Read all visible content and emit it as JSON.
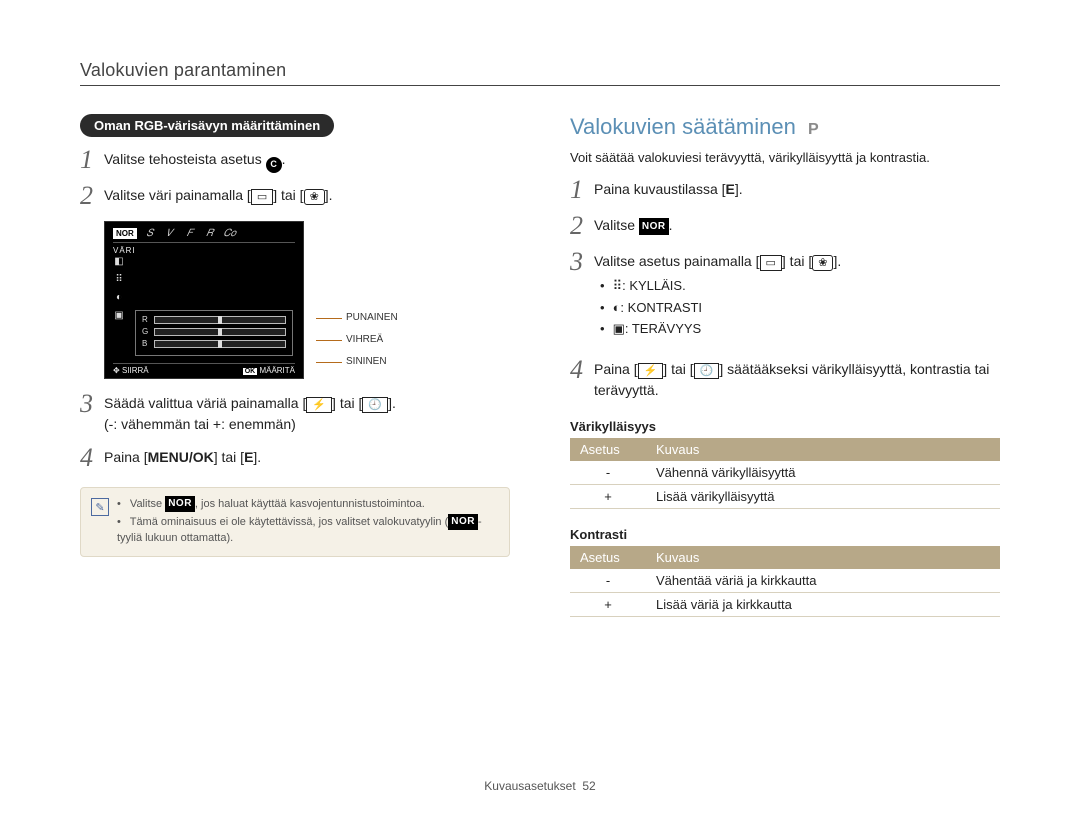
{
  "breadcrumb": "Valokuvien parantaminen",
  "left": {
    "pill": "Oman RGB-värisävyn määrittäminen",
    "step1": "Valitse tehosteista asetus ",
    "step1_icon_name": "C",
    "step2_a": "Valitse väri painamalla [",
    "step2_b": "] tai [",
    "step2_c": "].",
    "lcd": {
      "nor": "NOR",
      "vari": "VÄRI",
      "r": "R",
      "g": "G",
      "b": "B",
      "siirra": "SIIRRÄ",
      "ok": "OK",
      "maarita": "MÄÄRITÄ"
    },
    "callouts": {
      "red": "PUNAINEN",
      "green": "VIHREÄ",
      "blue": "SININEN"
    },
    "step3_a": "Säädä valittua väriä painamalla [",
    "step3_b": "] tai [",
    "step3_c": "].",
    "step3_sub": "(-: vähemmän tai +: enemmän)",
    "step4_a": "Paina [",
    "step4_menu": "MENU/OK",
    "step4_b": "] tai [",
    "step4_e": "E",
    "step4_c": "].",
    "note1_a": "Valitse ",
    "note1_nor": "NOR",
    "note1_b": ", jos haluat käyttää kasvojentunnistustoimintoa.",
    "note2_a": "Tämä ominaisuus ei ole käytettävissä, jos valitset valokuvatyylin (",
    "note2_nor": "NOR",
    "note2_b": "-tyyliä lukuun ottamatta)."
  },
  "right": {
    "title": "Valokuvien säätäminen",
    "title_mode": "P",
    "intro": "Voit säätää valokuviesi terävyyttä, värikylläisyyttä ja kontrastia.",
    "step1_a": "Paina kuvaustilassa [",
    "step1_e": "E",
    "step1_b": "].",
    "step2_a": "Valitse ",
    "step2_nor": "NOR",
    "step2_b": ".",
    "step3_a": "Valitse asetus painamalla [",
    "step3_b": "] tai [",
    "step3_c": "].",
    "bullets": {
      "sat": ": KYLLÄIS.",
      "con": ": KONTRASTI",
      "sha": ": TERÄVYYS"
    },
    "step4_a": "Paina [",
    "step4_b": "] tai [",
    "step4_c": "] säätääkseksi värikylläisyyttä, kontrastia tai terävyyttä.",
    "sec1_label": "Värikylläisyys",
    "th1": "Asetus",
    "th2": "Kuvaus",
    "t1r1c1": "-",
    "t1r1c2": "Vähennä värikylläisyyttä",
    "t1r2c1": "+",
    "t1r2c2": "Lisää värikylläisyyttä",
    "sec2_label": "Kontrasti",
    "t2r1c1": "-",
    "t2r1c2": "Vähentää väriä ja kirkkautta",
    "t2r2c1": "+",
    "t2r2c2": "Lisää väriä ja kirkkautta"
  },
  "footer_a": "Kuvausasetukset",
  "footer_page": "52"
}
